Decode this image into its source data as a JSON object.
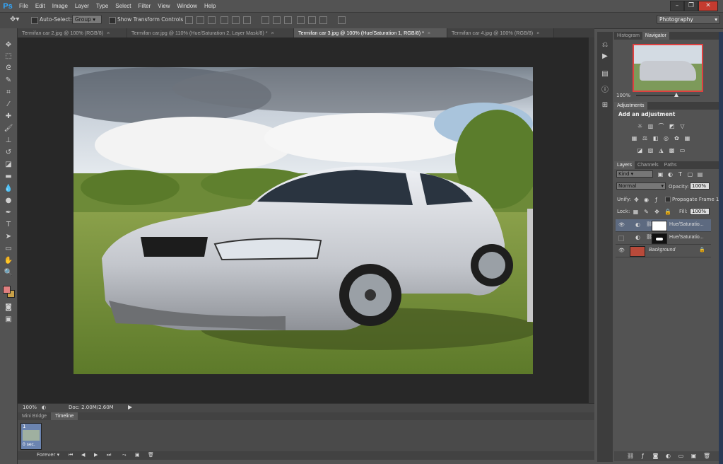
{
  "app": {
    "logo": "Ps"
  },
  "menu": [
    "File",
    "Edit",
    "Image",
    "Layer",
    "Type",
    "Select",
    "Filter",
    "View",
    "Window",
    "Help"
  ],
  "window_controls": {
    "minimize": "–",
    "restore": "❐",
    "close": "✕"
  },
  "options_bar": {
    "auto_select_label": "Auto-Select:",
    "auto_select_value": "Group",
    "show_transform_label": "Show Transform Controls",
    "workspace": "Photography"
  },
  "tabs": [
    {
      "label": "Termifan car 2.jpg @ 100% (RGB/8)"
    },
    {
      "label": "Termifan car.jpg @ 110% (Hue/Saturation 2, Layer Mask/8) *"
    },
    {
      "label": "Termifan car 3.jpg @ 100% (Hue/Saturation 1, RGB/8) *"
    },
    {
      "label": "Termifan car 4.jpg @ 100% (RGB/8)"
    }
  ],
  "tab_close": "×",
  "status": {
    "zoom": "100%",
    "doc": "Doc: 2.00M/2.60M"
  },
  "bottom_tabs": [
    "Mini Bridge",
    "Timeline"
  ],
  "timeline": {
    "frame_number": "1",
    "frame_delay": "0 sec.",
    "loop": "Forever"
  },
  "navigator": {
    "tabs": [
      "Histogram",
      "Navigator"
    ],
    "zoom": "100%"
  },
  "adjustments": {
    "title": "Adjustments",
    "subtitle": "Add an adjustment"
  },
  "layers_panel": {
    "tabs": [
      "Layers",
      "Channels",
      "Paths"
    ],
    "filter_kind": "Kind",
    "blend_mode": "Normal",
    "opacity_label": "Opacity:",
    "opacity_value": "100%",
    "unify_label": "Unify:",
    "propagate_label": "Propagate Frame 1",
    "lock_label": "Lock:",
    "fill_label": "Fill:",
    "fill_value": "100%",
    "layers": [
      {
        "name": "Hue/Saturatio...",
        "visible": true,
        "selected": true
      },
      {
        "name": "Hue/Saturatio...",
        "visible": false,
        "selected": false
      },
      {
        "name": "Background",
        "visible": true,
        "selected": false
      }
    ]
  },
  "colors": {
    "foreground": "#e07f7f",
    "background": "#c8a048",
    "selection": "#5d6a80",
    "accent": "#31a8ff"
  }
}
